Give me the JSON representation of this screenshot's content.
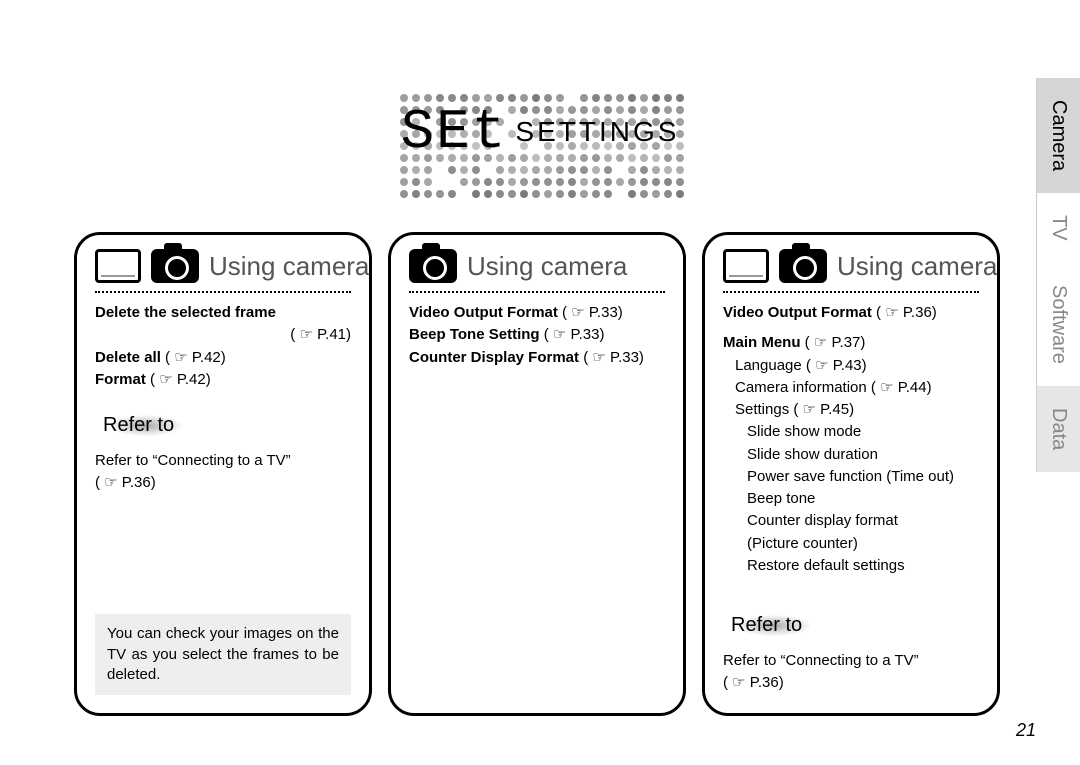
{
  "header": {
    "lcd": "SEt",
    "label": "SETTINGS"
  },
  "panels": [
    {
      "title": "Using camera & TV",
      "lines": {
        "l1": "Delete the selected frame",
        "l1b": "P.41)",
        "l2": "Delete all",
        "l2b": "P.42)",
        "l3": "Format",
        "l3b": "P.42)"
      },
      "refer": "Refer to",
      "refer_text": "Refer to “Connecting to a TV”",
      "refer_page": "P.36)",
      "note": "You can check your images on the TV as you select the frames to be deleted."
    },
    {
      "title": "Using camera",
      "lines": {
        "l1": "Video Output Format",
        "l1b": "P.33)",
        "l2": "Beep Tone Setting",
        "l2b": "P.33)",
        "l3": "Counter Display Format",
        "l3b": "P.33)"
      }
    },
    {
      "title": "Using camera & TV",
      "lines": {
        "l1": "Video Output Format",
        "l1b": "P.36)",
        "l2": "Main Menu",
        "l2b": "P.37)",
        "sub1": "Language",
        "sub1b": "P.43)",
        "sub2": "Camera information",
        "sub2b": "P.44)",
        "sub3": "Settings",
        "sub3b": "P.45)",
        "s1": "Slide show mode",
        "s2": "Slide show duration",
        "s3": "Power save function (Time out)",
        "s4": "Beep tone",
        "s5": "Counter display format",
        "s6": "(Picture counter)",
        "s7": "Restore default settings"
      },
      "refer": "Refer to",
      "refer_text": "Refer to “Connecting to a TV”",
      "refer_page": "P.36)"
    }
  ],
  "tabs": {
    "t1": "Camera",
    "t2": "TV",
    "t3": "Software",
    "t4": "Data"
  },
  "page_number": "21"
}
